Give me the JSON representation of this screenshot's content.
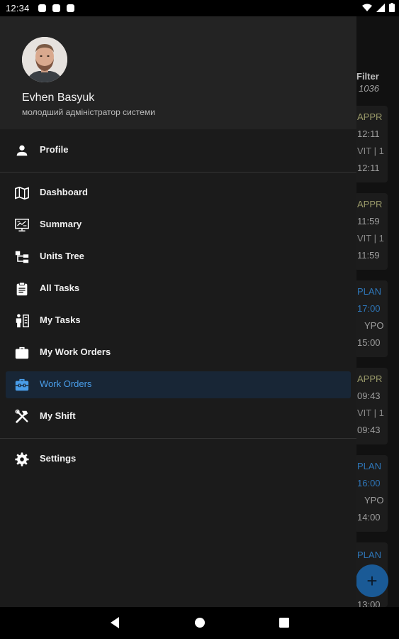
{
  "status_bar": {
    "time": "12:34",
    "notification_icons": [
      "gmail-icon",
      "sd-card-icon",
      "gmail-icon"
    ],
    "system_icons": [
      "wifi-icon",
      "signal-icon",
      "battery-icon"
    ]
  },
  "background": {
    "filter_label": "Filter",
    "filter_count": "1036",
    "cards": [
      {
        "lines": [
          "APPR",
          "12:11",
          "VIT | 1",
          "12:11"
        ],
        "status": "appr"
      },
      {
        "lines": [
          "APPR",
          "11:59",
          "VIT | 1",
          "11:59"
        ],
        "status": "appr"
      },
      {
        "lines": [
          "PLAN",
          "17:00",
          "YPO",
          "15:00"
        ],
        "status": "plan"
      },
      {
        "lines": [
          "APPR",
          "09:43",
          "VIT | 1",
          "09:43"
        ],
        "status": "appr"
      },
      {
        "lines": [
          "PLAN",
          "16:00",
          "YPO",
          "14:00"
        ],
        "status": "plan"
      },
      {
        "lines": [
          "PLAN",
          "13:00"
        ],
        "status": "plan"
      }
    ],
    "fab_label": "+"
  },
  "drawer": {
    "user": {
      "name": "Evhen Basyuk",
      "role": "молодший адміністратор системи"
    },
    "items": [
      {
        "label": "Profile",
        "icon": "person-icon"
      },
      {
        "label": "Dashboard",
        "icon": "map-icon"
      },
      {
        "label": "Summary",
        "icon": "monitor-chart-icon"
      },
      {
        "label": "Units Tree",
        "icon": "tree-icon"
      },
      {
        "label": "All Tasks",
        "icon": "clipboard-icon"
      },
      {
        "label": "My Tasks",
        "icon": "person-list-icon"
      },
      {
        "label": "My Work Orders",
        "icon": "briefcase-icon"
      },
      {
        "label": "Work Orders",
        "icon": "toolbox-icon",
        "active": true
      },
      {
        "label": "My Shift",
        "icon": "tools-icon"
      },
      {
        "label": "Settings",
        "icon": "gear-icon"
      }
    ]
  },
  "colors": {
    "accent": "#4a9eea",
    "drawer_bg": "#1b1b1b",
    "header_bg": "#232323",
    "active_bg": "#182636",
    "plan": "#2e76b8"
  },
  "nav_bar": {
    "buttons": [
      "back-icon",
      "home-icon",
      "recents-icon"
    ]
  }
}
